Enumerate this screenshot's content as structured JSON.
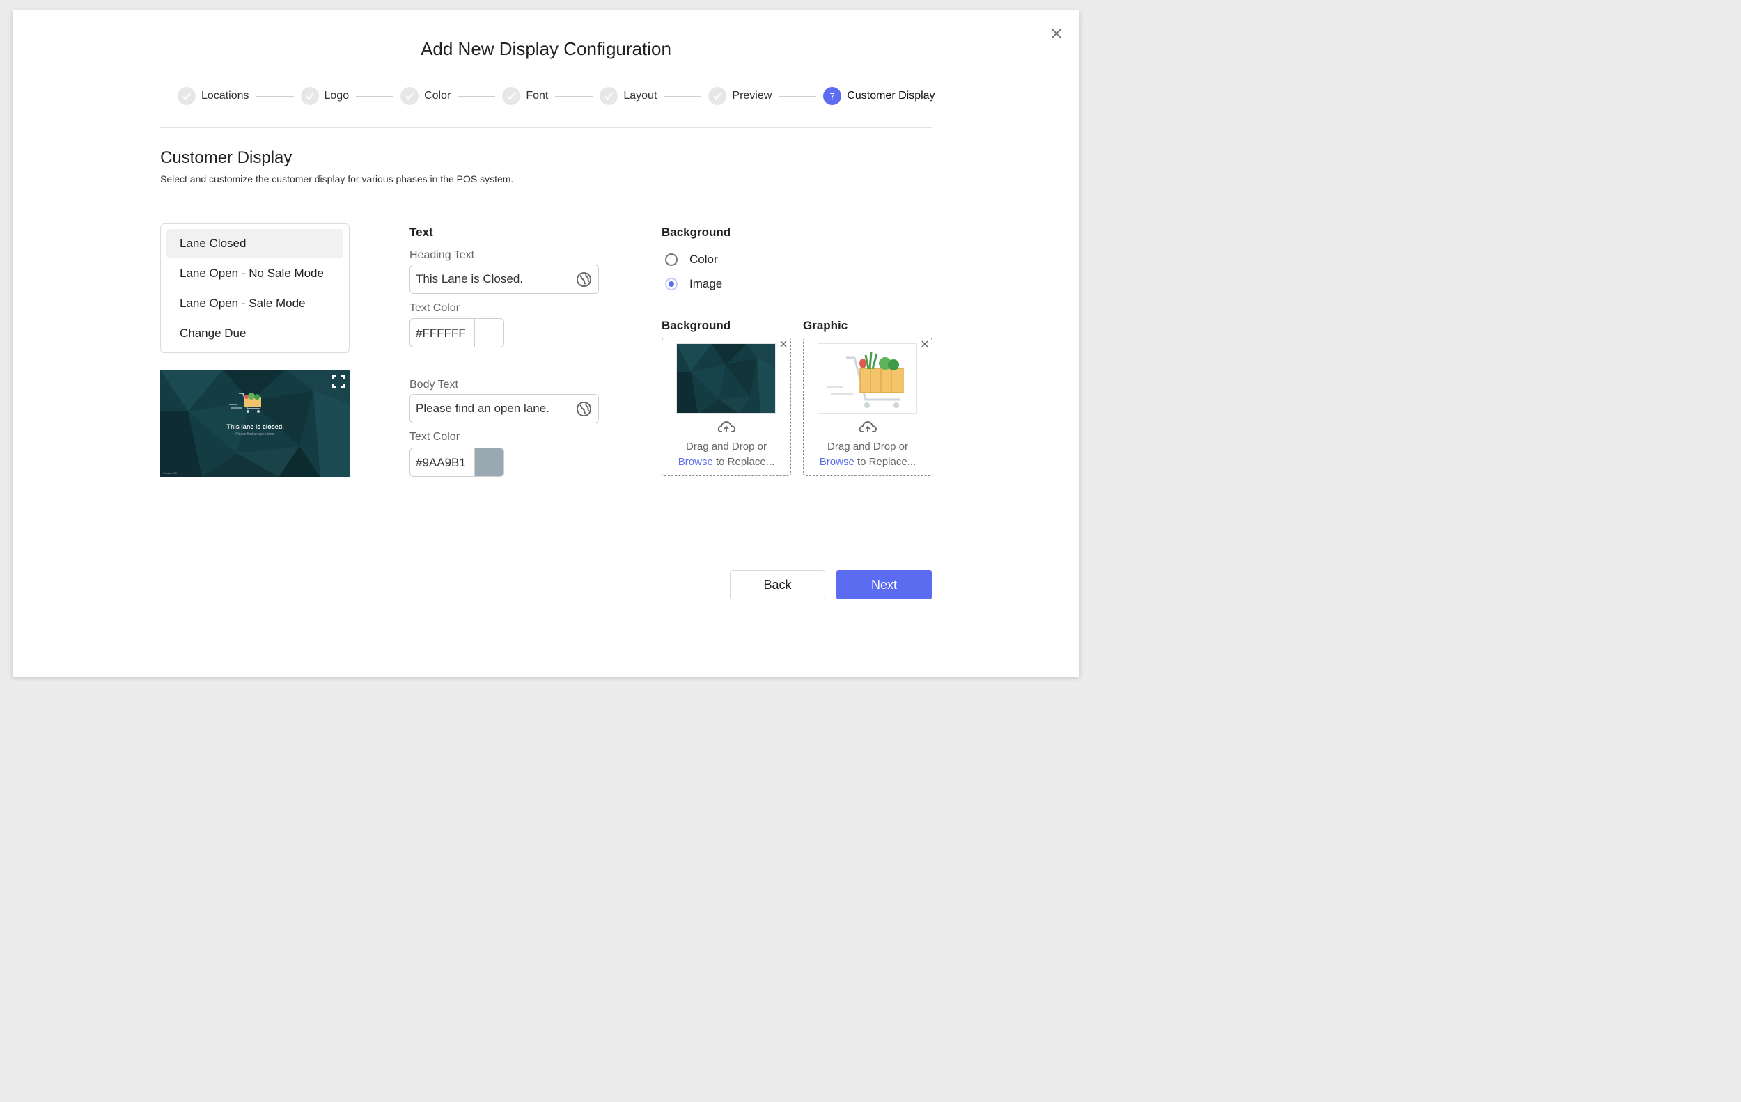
{
  "dialog": {
    "title": "Add New Display Configuration",
    "close_icon": "close-icon"
  },
  "stepper": {
    "steps": [
      {
        "label": "Locations",
        "status": "complete"
      },
      {
        "label": "Logo",
        "status": "complete"
      },
      {
        "label": "Color",
        "status": "complete"
      },
      {
        "label": "Font",
        "status": "complete"
      },
      {
        "label": "Layout",
        "status": "complete"
      },
      {
        "label": "Preview",
        "status": "complete"
      },
      {
        "label": "Customer Display",
        "status": "active",
        "number": "7"
      }
    ]
  },
  "section": {
    "title": "Customer Display",
    "subtitle": "Select and customize the customer display for various phases in the POS system."
  },
  "phases": {
    "items": [
      "Lane Closed",
      "Lane Open - No Sale Mode",
      "Lane Open - Sale Mode",
      "Change Due"
    ],
    "selected": "Lane Closed"
  },
  "preview": {
    "heading": "This lane is closed.",
    "body": "Please find an open lane.",
    "version": "Version 4.0"
  },
  "text": {
    "heading": "Text",
    "heading_text_label": "Heading Text",
    "heading_text_value": "This Lane is Closed.",
    "heading_color_label": "Text Color",
    "heading_color_value": "#FFFFFF",
    "body_text_label": "Body Text",
    "body_text_value": "Please find an open lane.",
    "body_color_label": "Text Color",
    "body_color_value": "#9AA9B1"
  },
  "background": {
    "heading": "Background",
    "options": [
      {
        "label": "Color",
        "checked": false
      },
      {
        "label": "Image",
        "checked": true
      }
    ]
  },
  "uploads": {
    "background": {
      "heading": "Background",
      "line1": "Drag and Drop or",
      "browse": "Browse",
      "rest": " to Replace..."
    },
    "graphic": {
      "heading": "Graphic",
      "line1": "Drag and Drop or",
      "browse": "Browse",
      "rest": " to Replace..."
    }
  },
  "footer": {
    "back_label": "Back",
    "next_label": "Next"
  },
  "colors": {
    "accent": "#5b6cf0",
    "preview_bg": "#133a40"
  }
}
